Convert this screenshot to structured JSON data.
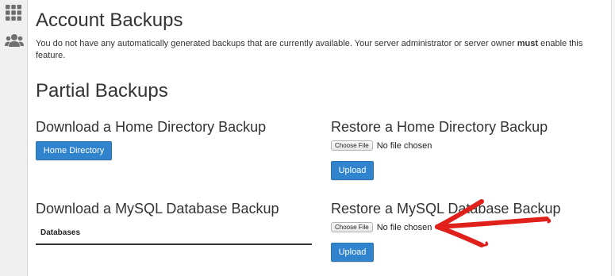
{
  "sidebar": {
    "items": [
      {
        "icon": "grid-icon"
      },
      {
        "icon": "users-icon"
      }
    ]
  },
  "page": {
    "title": "Account Backups",
    "notice_pre": "You do not have any automatically generated backups that are currently available. Your server administrator or server owner ",
    "notice_bold": "must",
    "notice_post": " enable this feature."
  },
  "partial": {
    "title": "Partial Backups",
    "download_home": {
      "title": "Download a Home Directory Backup",
      "button_label": "Home Directory"
    },
    "restore_home": {
      "title": "Restore a Home Directory Backup",
      "choose_label": "Choose File",
      "file_status": "No file chosen",
      "upload_label": "Upload"
    },
    "download_mysql": {
      "title": "Download a MySQL Database Backup",
      "table_header": "Databases"
    },
    "restore_mysql": {
      "title": "Restore a MySQL Database Backup",
      "choose_label": "Choose File",
      "file_status": "No file chosen",
      "upload_label": "Upload"
    }
  },
  "colors": {
    "primary_button": "#2f84cd",
    "annotation_arrow": "#e0201b"
  }
}
